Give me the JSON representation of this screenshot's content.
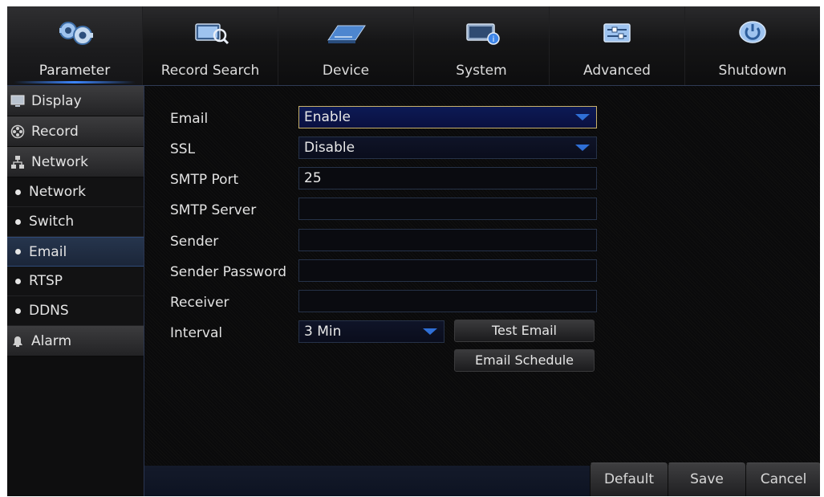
{
  "nav": {
    "tabs": [
      {
        "label": "Parameter",
        "icon": "gears-icon",
        "active": true
      },
      {
        "label": "Record Search",
        "icon": "film-search-icon",
        "active": false
      },
      {
        "label": "Device",
        "icon": "hard-drive-icon",
        "active": false
      },
      {
        "label": "System",
        "icon": "monitor-info-icon",
        "active": false
      },
      {
        "label": "Advanced",
        "icon": "sliders-icon",
        "active": false
      },
      {
        "label": "Shutdown",
        "icon": "power-icon",
        "active": false
      }
    ]
  },
  "sidebar": {
    "items": [
      {
        "label": "Display",
        "kind": "category",
        "icon": "monitor-icon"
      },
      {
        "label": "Record",
        "kind": "category",
        "icon": "film-reel-icon"
      },
      {
        "label": "Network",
        "kind": "category",
        "icon": "network-icon"
      },
      {
        "label": "Network",
        "kind": "sub"
      },
      {
        "label": "Switch",
        "kind": "sub"
      },
      {
        "label": "Email",
        "kind": "sub",
        "active": true
      },
      {
        "label": "RTSP",
        "kind": "sub"
      },
      {
        "label": "DDNS",
        "kind": "sub"
      },
      {
        "label": "Alarm",
        "kind": "category",
        "icon": "alarm-bell-icon"
      }
    ]
  },
  "form": {
    "email": {
      "label": "Email",
      "value": "Enable"
    },
    "ssl": {
      "label": "SSL",
      "value": "Disable"
    },
    "smtp_port": {
      "label": "SMTP Port",
      "value": "25"
    },
    "smtp_server": {
      "label": "SMTP Server",
      "value": ""
    },
    "sender": {
      "label": "Sender",
      "value": ""
    },
    "sender_password": {
      "label": "Sender Password",
      "value": ""
    },
    "receiver": {
      "label": "Receiver",
      "value": ""
    },
    "interval": {
      "label": "Interval",
      "value": "3 Min"
    },
    "test_email_label": "Test Email",
    "email_schedule_label": "Email Schedule"
  },
  "footer": {
    "default_label": "Default",
    "save_label": "Save",
    "cancel_label": "Cancel"
  },
  "colors": {
    "accent": "#3d86ff",
    "focus_border": "#c8b16a",
    "dropdown_arrow": "#2f6fd6"
  }
}
